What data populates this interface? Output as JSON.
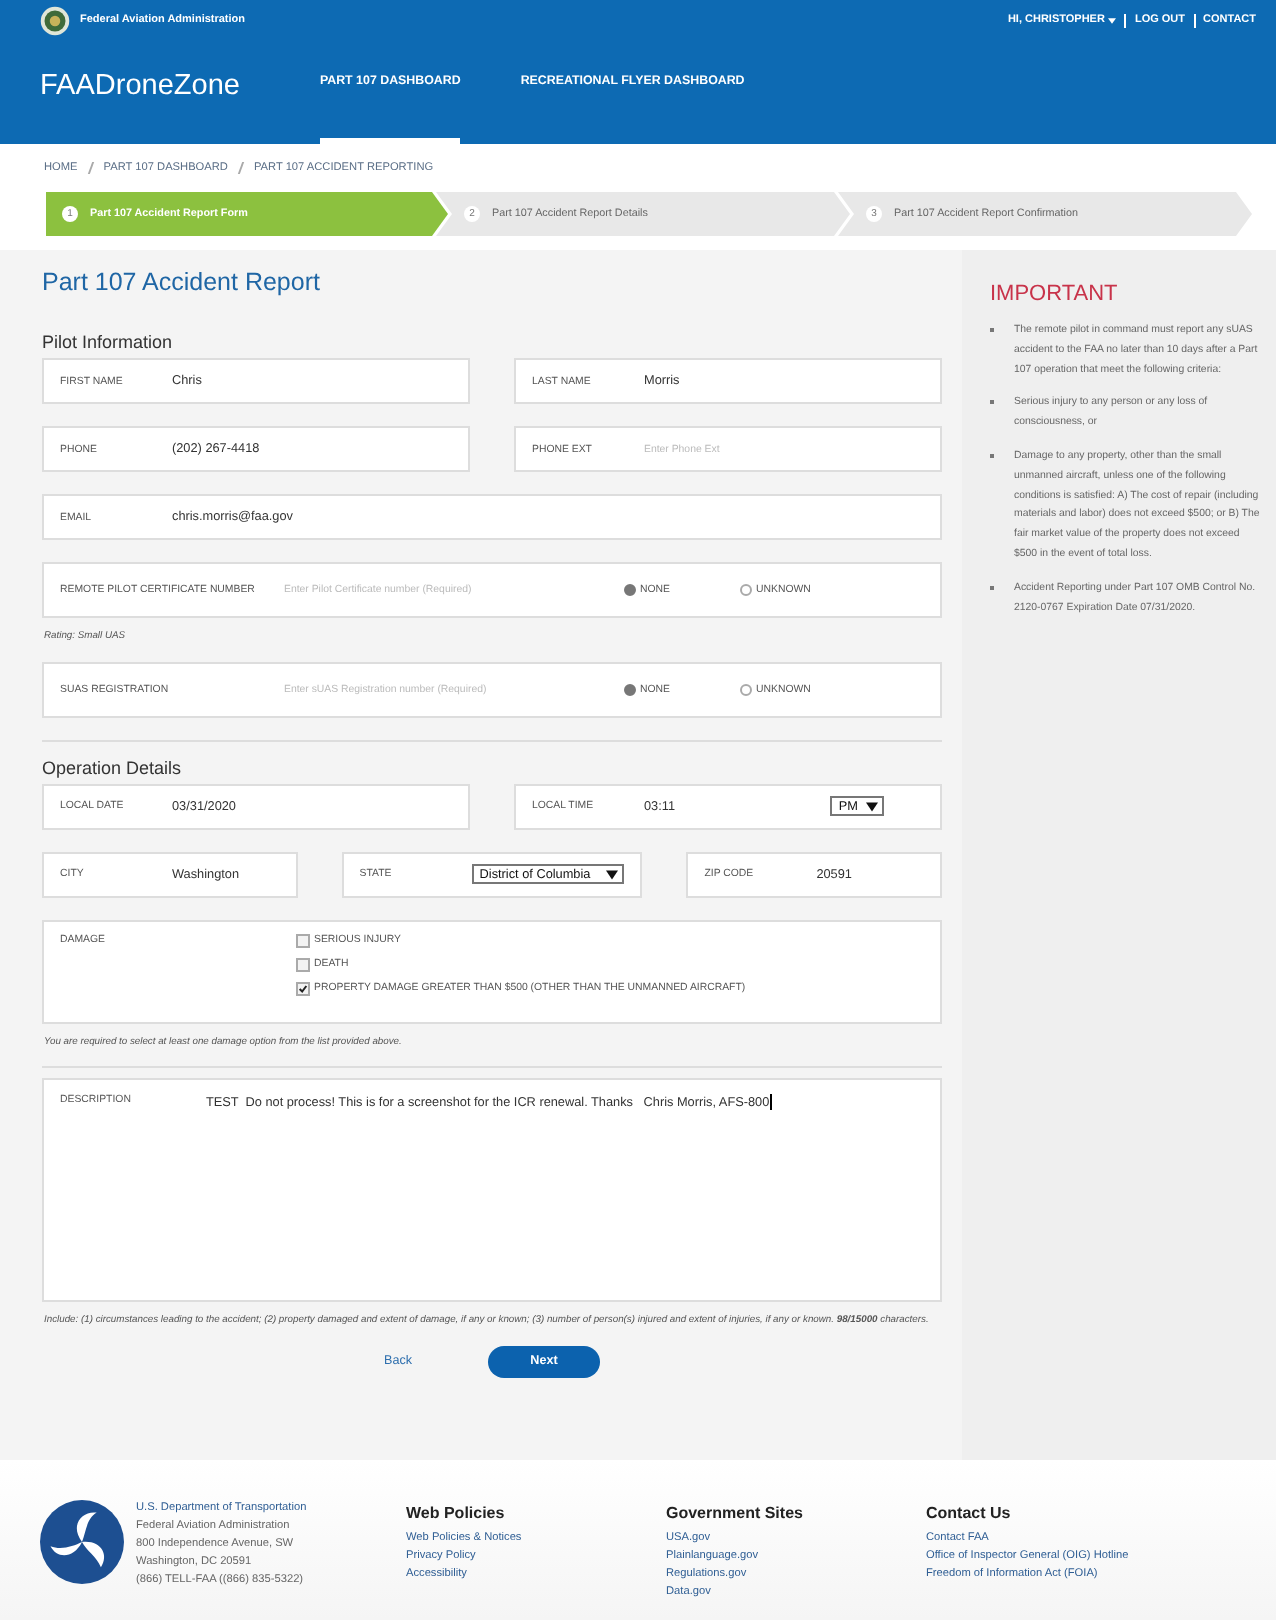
{
  "header": {
    "agency": "Federal Aviation Administration",
    "user_links": [
      {
        "label": "HI, CHRISTOPHER",
        "dropdown": true
      },
      {
        "label": "LOG OUT",
        "dropdown": false
      },
      {
        "label": "CONTACT",
        "dropdown": false
      }
    ],
    "brand": "FAADroneZone",
    "nav": [
      {
        "label": "PART 107 DASHBOARD",
        "selected": true
      },
      {
        "label": "RECREATIONAL FLYER DASHBOARD",
        "selected": false
      }
    ]
  },
  "breadcrumbs": [
    "HOME",
    "PART 107 DASHBOARD",
    "PART 107 ACCIDENT REPORTING"
  ],
  "steps": [
    {
      "number": "1",
      "label": "Part 107 Accident Report Form",
      "selected": true
    },
    {
      "number": "2",
      "label": "Part 107 Accident Report Details",
      "selected": false
    },
    {
      "number": "3",
      "label": "Part 107 Accident Report Confirmation",
      "selected": false
    }
  ],
  "title": "Part 107 Accident Report",
  "sections": [
    {
      "heading": "Pilot Information",
      "rows": [
        {
          "kind": "fields",
          "fields": [
            {
              "kind": "input",
              "label": "FIRST NAME",
              "value": "Chris"
            },
            {
              "kind": "input",
              "label": "LAST NAME",
              "value": "Morris"
            }
          ]
        },
        {
          "kind": "fields",
          "fields": [
            {
              "kind": "input",
              "label": "PHONE",
              "value": "(202) 267-4418"
            },
            {
              "kind": "input",
              "label": "PHONE EXT",
              "placeholder": "Enter Phone Ext"
            }
          ]
        },
        {
          "kind": "fields",
          "fields": [
            {
              "kind": "input",
              "label": "EMAIL",
              "value": "chris.morris@faa.gov"
            }
          ]
        },
        {
          "kind": "fields",
          "fields": [
            {
              "kind": "radio",
              "label": "REMOTE PILOT CERTIFICATE NUMBER",
              "placeholder": "Enter Pilot Certificate number (Required)",
              "options": [
                {
                  "label": "NONE",
                  "selected": true
                },
                {
                  "label": "UNKNOWN",
                  "selected": false
                }
              ]
            }
          ]
        },
        {
          "kind": "note",
          "text": "Rating: Small UAS"
        },
        {
          "kind": "fields",
          "fields": [
            {
              "kind": "radio",
              "label": "SUAS REGISTRATION",
              "placeholder": "Enter sUAS Registration number (Required)",
              "options": [
                {
                  "label": "NONE",
                  "selected": true
                },
                {
                  "label": "UNKNOWN",
                  "selected": false
                }
              ]
            }
          ]
        }
      ]
    },
    {
      "heading": "Operation Details",
      "rows": [
        {
          "kind": "fields",
          "fields": [
            {
              "kind": "input",
              "label": "LOCAL DATE",
              "value": "03/31/2020"
            },
            {
              "kind": "input",
              "label": "LOCAL TIME",
              "value": "03:11",
              "select": "PM"
            }
          ]
        },
        {
          "kind": "fields",
          "fields": [
            {
              "kind": "input",
              "label": "CITY",
              "value": "Washington"
            },
            {
              "kind": "select",
              "label": "STATE",
              "value": "District of Columbia"
            },
            {
              "kind": "input",
              "label": "ZIP CODE",
              "value": "20591"
            }
          ]
        },
        {
          "kind": "fields",
          "fields": [
            {
              "kind": "checks",
              "label": "DAMAGE",
              "options": [
                {
                  "label": "SERIOUS INJURY",
                  "checked": false
                },
                {
                  "label": "DEATH",
                  "checked": false
                },
                {
                  "label": "PROPERTY DAMAGE GREATER THAN $500 (OTHER THAN THE UNMANNED AIRCRAFT)",
                  "checked": true
                }
              ]
            }
          ]
        },
        {
          "kind": "note",
          "text": "You are required to select at least one damage option from the list provided above."
        },
        {
          "kind": "rule"
        },
        {
          "kind": "fields",
          "fields": [
            {
              "kind": "textarea",
              "label": "DESCRIPTION",
              "value": "TEST  Do not process! This is for a screenshot for the ICR renewal. Thanks   Chris Morris, AFS-800"
            }
          ]
        },
        {
          "kind": "note",
          "text": "Include: (1) circumstances leading to the accident; (2) property damaged and extent of damage, if any or known; (3) number of person(s) injured and extent of injuries, if any or known. **98/15000** characters."
        }
      ]
    }
  ],
  "buttons": {
    "back": "Back",
    "next": "Next"
  },
  "sidebar": {
    "heading": "IMPORTANT",
    "items": [
      "The remote pilot in command must report any sUAS accident to the FAA no later than 10 days after a Part 107 operation that meet the following criteria:",
      "Serious injury to any person or any loss of consciousness, or",
      "Damage to any property, other than the small unmanned aircraft, unless one of the following conditions is satisfied: A) The cost of repair (including materials and labor) does not exceed $500; or B) The fair market value of the property does not exceed $500 in the event of total loss.",
      "Accident Reporting under Part 107 OMB Control No. 2120-0767 Expiration Date 07/31/2020."
    ]
  },
  "footer": {
    "address": [
      "U.S. Department of Transportation",
      "Federal Aviation Administration",
      "800 Independence Avenue, SW",
      "Washington, DC 20591",
      "(866) TELL-FAA ((866) 835-5322)"
    ],
    "columns": [
      {
        "heading": "Web Policies",
        "links": [
          "Web Policies & Notices",
          "Privacy Policy",
          "Accessibility"
        ]
      },
      {
        "heading": "Government Sites",
        "links": [
          "USA.gov",
          "Plainlanguage.gov",
          "Regulations.gov",
          "Data.gov"
        ]
      },
      {
        "heading": "Contact Us",
        "links": [
          "Contact FAA",
          "Office of Inspector General (OIG) Hotline",
          "Freedom of Information Act (FOIA)"
        ]
      }
    ]
  }
}
